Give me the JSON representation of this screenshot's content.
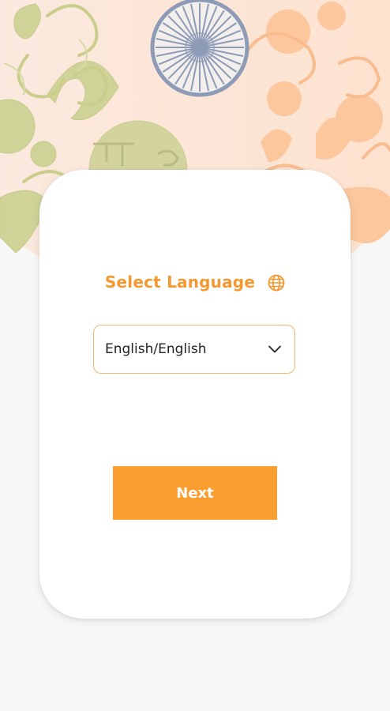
{
  "screen": {
    "background_color": "#f7f7f7"
  },
  "header": {
    "decoration": "indian-floral-pattern-with-ashoka-chakra",
    "colors": {
      "olive": "#cfd397",
      "peach": "#fcc79d",
      "chakra": "#8d9bb7",
      "base": "#fde6d6"
    }
  },
  "card": {
    "title": "Select Language",
    "title_icon": "globe-icon",
    "accent_color": "#f6982f",
    "language_select": {
      "selected_value": "English/English",
      "icon": "chevron-down-icon"
    },
    "next_button": {
      "label": "Next",
      "color": "#fb9f31"
    }
  }
}
